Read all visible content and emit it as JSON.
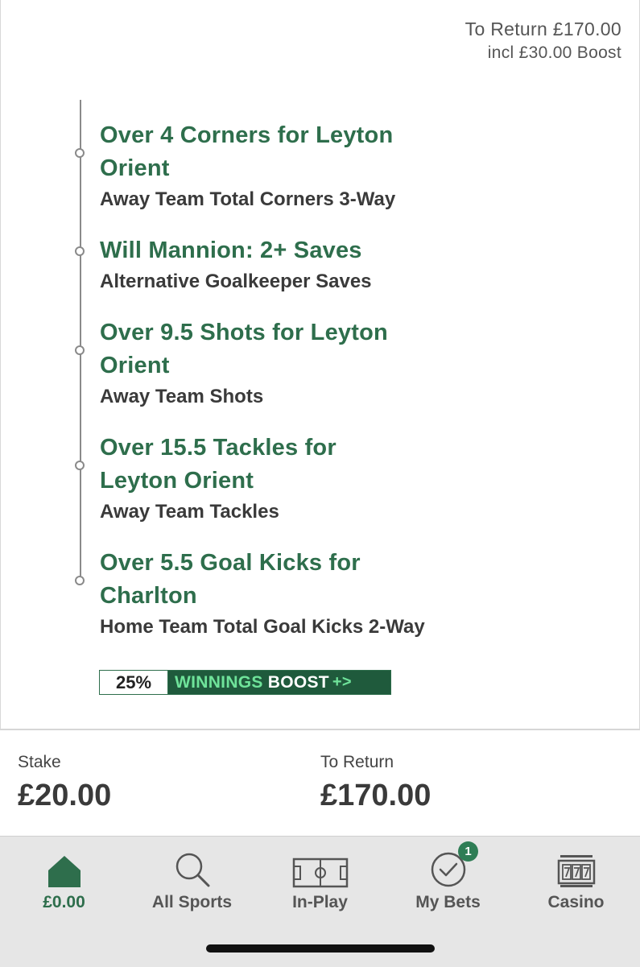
{
  "header": {
    "to_return_line": "To Return £170.00",
    "boost_line": "incl £30.00 Boost"
  },
  "legs": [
    {
      "selection_line1": "Over 4 Corners for Leyton",
      "selection_line2": "Orient",
      "market": "Away Team Total Corners 3-Way"
    },
    {
      "selection_line1": "Will Mannion: 2+ Saves",
      "selection_line2": "",
      "market": "Alternative Goalkeeper Saves"
    },
    {
      "selection_line1": "Over 9.5 Shots for Leyton",
      "selection_line2": "Orient",
      "market": "Away Team Shots"
    },
    {
      "selection_line1": "Over 15.5 Tackles for",
      "selection_line2": "Leyton Orient",
      "market": "Away Team Tackles"
    },
    {
      "selection_line1": "Over 5.5 Goal Kicks for",
      "selection_line2": "Charlton",
      "market": "Home Team Total Goal Kicks 2-Way"
    }
  ],
  "boost_badge": {
    "percent": "25%",
    "word1": "WINNINGS",
    "word2": "BOOST",
    "arrow": "+>"
  },
  "stake": {
    "label": "Stake",
    "value": "£20.00"
  },
  "to_return": {
    "label": "To Return",
    "value": "£170.00"
  },
  "tabs": [
    {
      "label": "£0.00",
      "icon": "home-icon",
      "active": true
    },
    {
      "label": "All Sports",
      "icon": "search-icon"
    },
    {
      "label": "In-Play",
      "icon": "pitch-icon"
    },
    {
      "label": "My Bets",
      "icon": "check-circle-icon",
      "badge": "1"
    },
    {
      "label": "Casino",
      "icon": "slot-machine-icon"
    }
  ],
  "colors": {
    "accent": "#2e6e4c",
    "badge_bg": "#1f5a3c",
    "boost_text": "#6fe39a"
  }
}
